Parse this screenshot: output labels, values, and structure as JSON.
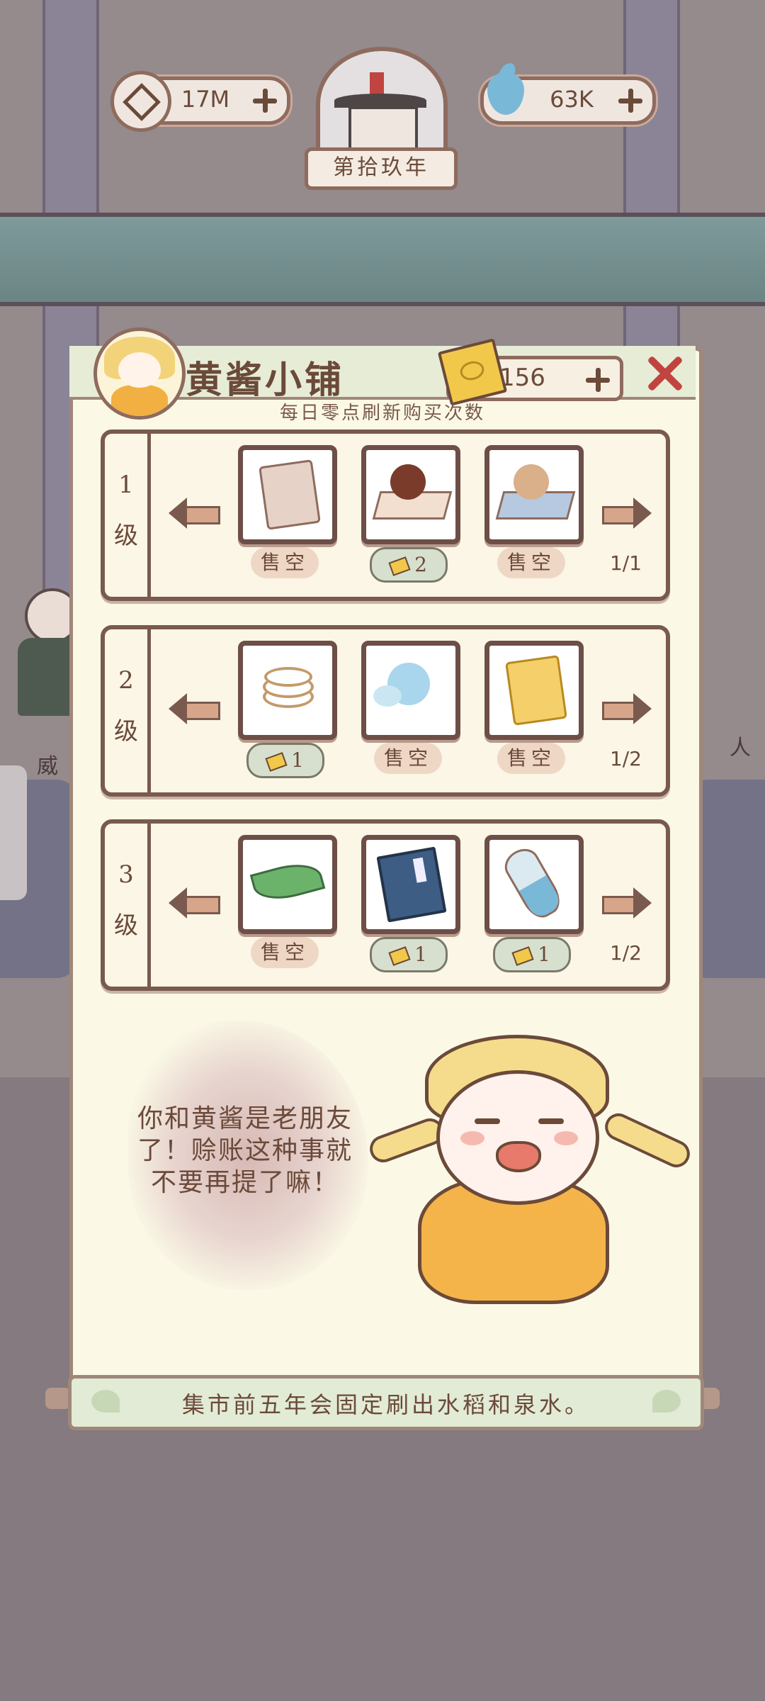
{
  "hud": {
    "currency_value": "17M",
    "water_value": "63K",
    "year_label": "第拾玖年"
  },
  "shop": {
    "title": "黄酱小铺",
    "ticket_count": "156",
    "refresh_note": "每日零点刷新购买次数",
    "tiers": [
      {
        "level_num": "1",
        "level_suffix": "级",
        "page": "1/1",
        "items": [
          {
            "icon": "cloth-bag-icon",
            "status": "售空"
          },
          {
            "icon": "brown-pearl-icon",
            "price": "2"
          },
          {
            "icon": "light-pearl-icon",
            "status": "售空"
          }
        ]
      },
      {
        "level_num": "2",
        "level_suffix": "级",
        "page": "1/2",
        "items": [
          {
            "icon": "coin-string-icon",
            "price": "1"
          },
          {
            "icon": "water-spirit-icon",
            "status": "售空"
          },
          {
            "icon": "gold-bag-icon",
            "status": "售空"
          }
        ]
      },
      {
        "level_num": "3",
        "level_suffix": "级",
        "page": "1/2",
        "items": [
          {
            "icon": "tea-leaf-icon",
            "status": "售空"
          },
          {
            "icon": "blue-book-icon",
            "price": "1"
          },
          {
            "icon": "water-vial-icon",
            "price": "1"
          }
        ]
      }
    ]
  },
  "dialog": {
    "text": "你和黄酱是老朋友了！赊账这种事就不要再提了嘛！"
  },
  "tip": {
    "text": "集市前五年会固定刷出水稻和泉水。"
  },
  "background": {
    "left_text": "威",
    "right_text": "人"
  },
  "colors": {
    "accent_red": "#c0443f",
    "panel_bg": "#fbf9e6",
    "border_brown": "#7a5a4e"
  }
}
